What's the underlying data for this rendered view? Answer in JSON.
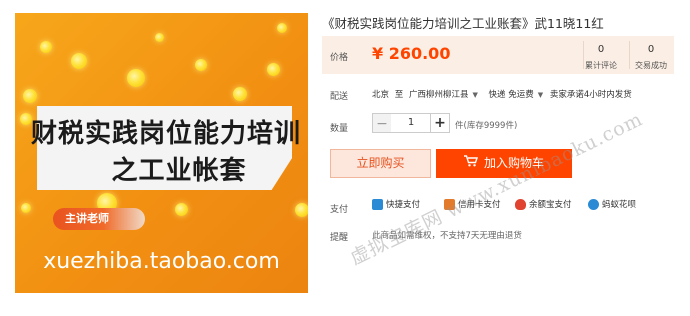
{
  "product_image": {
    "headline_line1": "财税实践岗位能力培训",
    "headline_line2": "之工业帐套",
    "teacher_tag": "主讲老师",
    "shop_url": "xuezhiba.taobao.com"
  },
  "title": "《财税实践岗位能力培训之工业账套》武11晓11红",
  "price": {
    "label": "价格",
    "value": "¥ 260.00"
  },
  "stats": [
    {
      "count": "0",
      "label": "累计评论"
    },
    {
      "count": "0",
      "label": "交易成功"
    }
  ],
  "shipping": {
    "label": "配送",
    "from": "北京",
    "to_word": "至",
    "destination": "广西柳州柳江县",
    "method": "快递 免运费",
    "promise": "卖家承诺4小时内发货"
  },
  "quantity": {
    "label": "数量",
    "minus": "−",
    "value": "1",
    "plus": "+",
    "stock": "件(库存9999件)"
  },
  "buttons": {
    "buy_now": "立即购买",
    "add_cart": "加入购物车"
  },
  "payment": {
    "label": "支付",
    "methods": [
      {
        "name": "快捷支付",
        "color": "#2a8ad4"
      },
      {
        "name": "信用卡支付",
        "color": "#e27b2c"
      },
      {
        "name": "余额宝支付",
        "color": "#e0432f"
      },
      {
        "name": "蚂蚁花呗",
        "color": "#2a8ad4"
      }
    ]
  },
  "hint": {
    "label": "提醒",
    "text": "此商品如需维权，不支持7天无理由退货"
  },
  "site_watermark": "虚拟宝库网 www.xunibaoku.com",
  "colors": {
    "accent": "#ff4400",
    "price_bg": "#fbeee4"
  }
}
